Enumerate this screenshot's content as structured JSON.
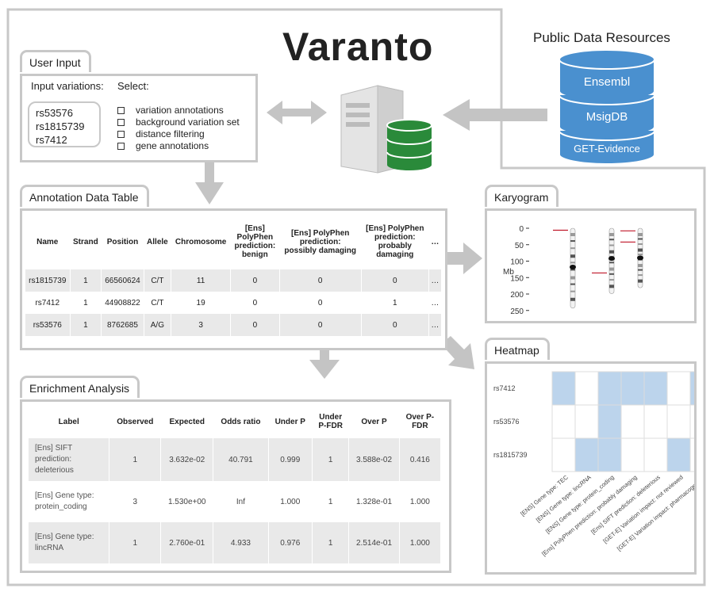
{
  "title": "Varanto",
  "public_resources": {
    "heading": "Public Data Resources",
    "databases": [
      "Ensembl",
      "MsigDB",
      "GET-Evidence"
    ]
  },
  "user_input": {
    "tab": "User Input",
    "input_label": "Input variations:",
    "select_label": "Select:",
    "variations": [
      "rs53576",
      "rs1815739",
      "rs7412"
    ],
    "options": [
      "variation annotations",
      "background variation set",
      "distance filtering",
      "gene annotations"
    ]
  },
  "annotation_table": {
    "tab": "Annotation Data Table",
    "columns": [
      "Name",
      "Strand",
      "Position",
      "Allele",
      "Chromosome",
      "[Ens]\nPolyPhen\nprediction:\nbenign",
      "[Ens] PolyPhen\nprediction:\npossibly damaging",
      "[Ens] PolyPhen\nprediction:\nprobably\ndamaging",
      "…"
    ],
    "rows": [
      [
        "rs1815739",
        "1",
        "66560624",
        "C/T",
        "11",
        "0",
        "0",
        "0",
        "…"
      ],
      [
        "rs7412",
        "1",
        "44908822",
        "C/T",
        "19",
        "0",
        "0",
        "1",
        "…"
      ],
      [
        "rs53576",
        "1",
        "8762685",
        "A/G",
        "3",
        "0",
        "0",
        "0",
        "…"
      ],
      [
        "…",
        "…",
        "…",
        "…",
        "…",
        "…",
        "…",
        "…",
        "…"
      ]
    ]
  },
  "enrichment": {
    "tab": "Enrichment Analysis",
    "columns": [
      "Label",
      "Observed",
      "Expected",
      "Odds ratio",
      "Under P",
      "Under\nP-FDR",
      "Over P",
      "Over P-\nFDR"
    ],
    "rows": [
      [
        "[Ens] SIFT\nprediction:\ndeleterious",
        "1",
        "3.632e-02",
        "40.791",
        "0.999",
        "1",
        "3.588e-02",
        "0.416"
      ],
      [
        "[Ens] Gene type:\nprotein_coding",
        "3",
        "1.530e+00",
        "Inf",
        "1.000",
        "1",
        "1.328e-01",
        "1.000"
      ],
      [
        "[Ens] Gene type:\nlincRNA",
        "1",
        "2.760e-01",
        "4.933",
        "0.976",
        "1",
        "2.514e-01",
        "1.000"
      ],
      [
        "…",
        "…",
        "…",
        "…",
        "…",
        "…",
        "…",
        "…"
      ]
    ]
  },
  "karyogram": {
    "tab": "Karyogram",
    "axis_label": "Mb",
    "ticks": [
      "0",
      "50",
      "100",
      "150",
      "200",
      "250"
    ],
    "tick_values": [
      0,
      50,
      100,
      150,
      200,
      250
    ],
    "chromosomes": [
      {
        "length": 243,
        "marker": 6,
        "centromere": 118
      },
      {
        "length": 199,
        "marker": 136,
        "centromere": 92
      },
      {
        "length": 181,
        "marker": [
          8,
          42
        ],
        "centromere": 90
      }
    ],
    "marker_color": "#c0182a"
  },
  "heatmap": {
    "tab": "Heatmap",
    "rows": [
      "rs7412",
      "rs53576",
      "rs1815739"
    ],
    "columns": [
      "[ENS] Gene type: TEC",
      "[ENS] Gene type: lincRNA",
      "[ENS] Gene type: protein_coding",
      "[Ens] PolyPhen prediction: probably damaging",
      "[Ens] SIFT prediction: deleterious",
      "[GET-E] Variation impact: not reviewed",
      "[GET-E] Variation impact: pharmacogenetic"
    ],
    "matrix": [
      [
        1,
        0,
        1,
        1,
        1,
        0,
        1
      ],
      [
        0,
        0,
        1,
        0,
        0,
        0,
        0
      ],
      [
        0,
        1,
        1,
        0,
        0,
        1,
        0
      ]
    ],
    "fill_color": "#bcd4ec"
  },
  "colors": {
    "border": "#c8c8c8",
    "arrow": "#c4c4c4",
    "db_blue": "#4a90cf",
    "db_green": "#2a8a3a"
  }
}
